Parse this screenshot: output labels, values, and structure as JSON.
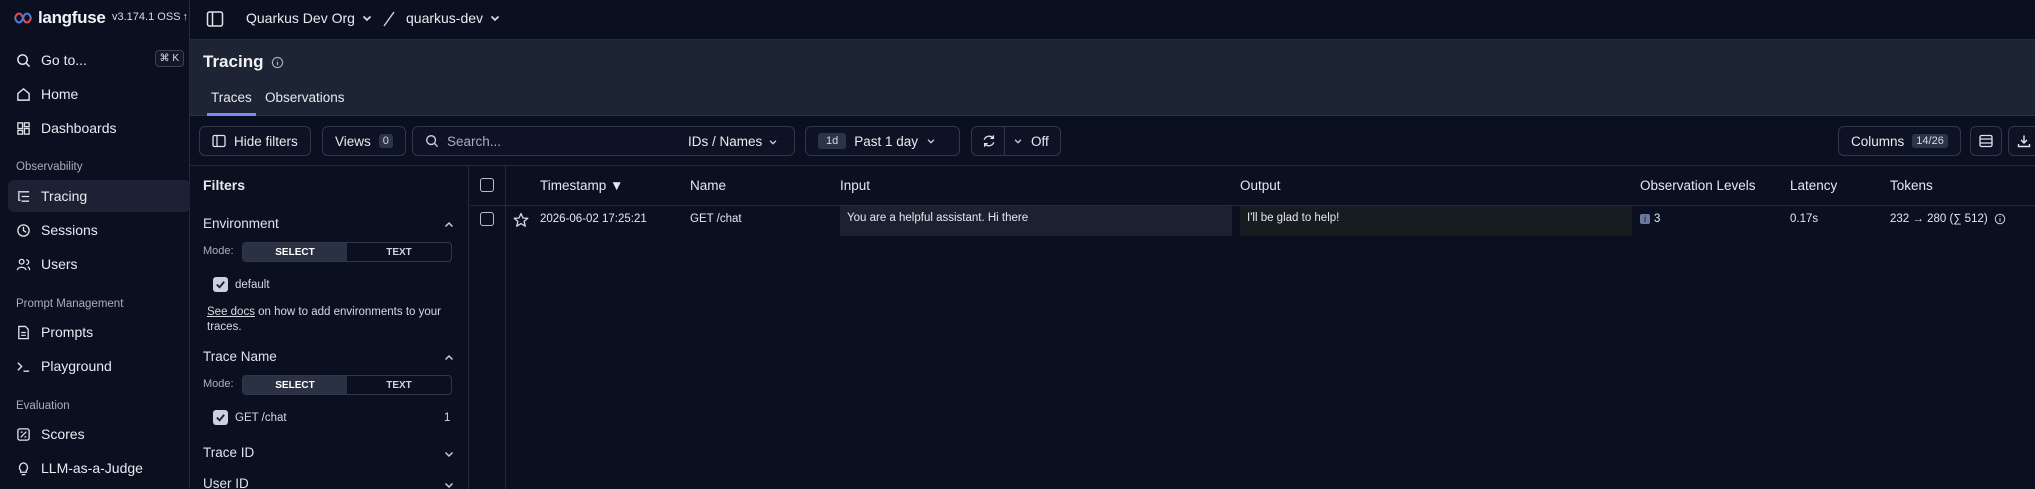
{
  "app": {
    "name": "langfuse",
    "version": "v3.174.1 OSS"
  },
  "sidebar": {
    "goto": {
      "label": "Go to...",
      "shortcut": "⌘ K"
    },
    "items": [
      {
        "label": "Home"
      },
      {
        "label": "Dashboards"
      }
    ],
    "sections": [
      {
        "title": "Observability",
        "items": [
          {
            "label": "Tracing"
          },
          {
            "label": "Sessions"
          },
          {
            "label": "Users"
          }
        ]
      },
      {
        "title": "Prompt Management",
        "items": [
          {
            "label": "Prompts"
          },
          {
            "label": "Playground"
          }
        ]
      },
      {
        "title": "Evaluation",
        "items": [
          {
            "label": "Scores"
          },
          {
            "label": "LLM-as-a-Judge"
          }
        ]
      }
    ]
  },
  "topbar": {
    "org": "Quarkus Dev Org",
    "project": "quarkus-dev"
  },
  "page": {
    "title": "Tracing",
    "tabs": [
      {
        "label": "Traces"
      },
      {
        "label": "Observations"
      }
    ]
  },
  "toolbar": {
    "hide_filters": "Hide filters",
    "views_label": "Views",
    "views_count": "0",
    "search_placeholder": "Search...",
    "search_scope": "IDs / Names",
    "range_short": "1d",
    "range_label": "Past 1 day",
    "refresh_label": "Off",
    "columns_label": "Columns",
    "columns_count": "14/26"
  },
  "filters": {
    "title": "Filters",
    "mode_label": "Mode:",
    "mode_select": "SELECT",
    "mode_text": "TEXT",
    "environment": {
      "title": "Environment",
      "option": "default",
      "docs_link": "See docs",
      "docs_text": " on how to add environments to your traces."
    },
    "trace_name": {
      "title": "Trace Name",
      "option": "GET /chat",
      "count": "1"
    },
    "trace_id": {
      "title": "Trace ID"
    },
    "user_id": {
      "title": "User ID"
    }
  },
  "table": {
    "headers": {
      "timestamp": "Timestamp ▼",
      "name": "Name",
      "input": "Input",
      "output": "Output",
      "levels": "Observation Levels",
      "latency": "Latency",
      "tokens": "Tokens"
    },
    "rows": [
      {
        "timestamp": "2026-06-02 17:25:21",
        "name": "GET /chat",
        "input": "You are a helpful assistant. Hi there",
        "output": "I'll be glad to help!",
        "level_badge": "i",
        "level_count": "3",
        "latency": "0.17s",
        "tokens": "232 → 280 (∑ 512)"
      }
    ]
  }
}
